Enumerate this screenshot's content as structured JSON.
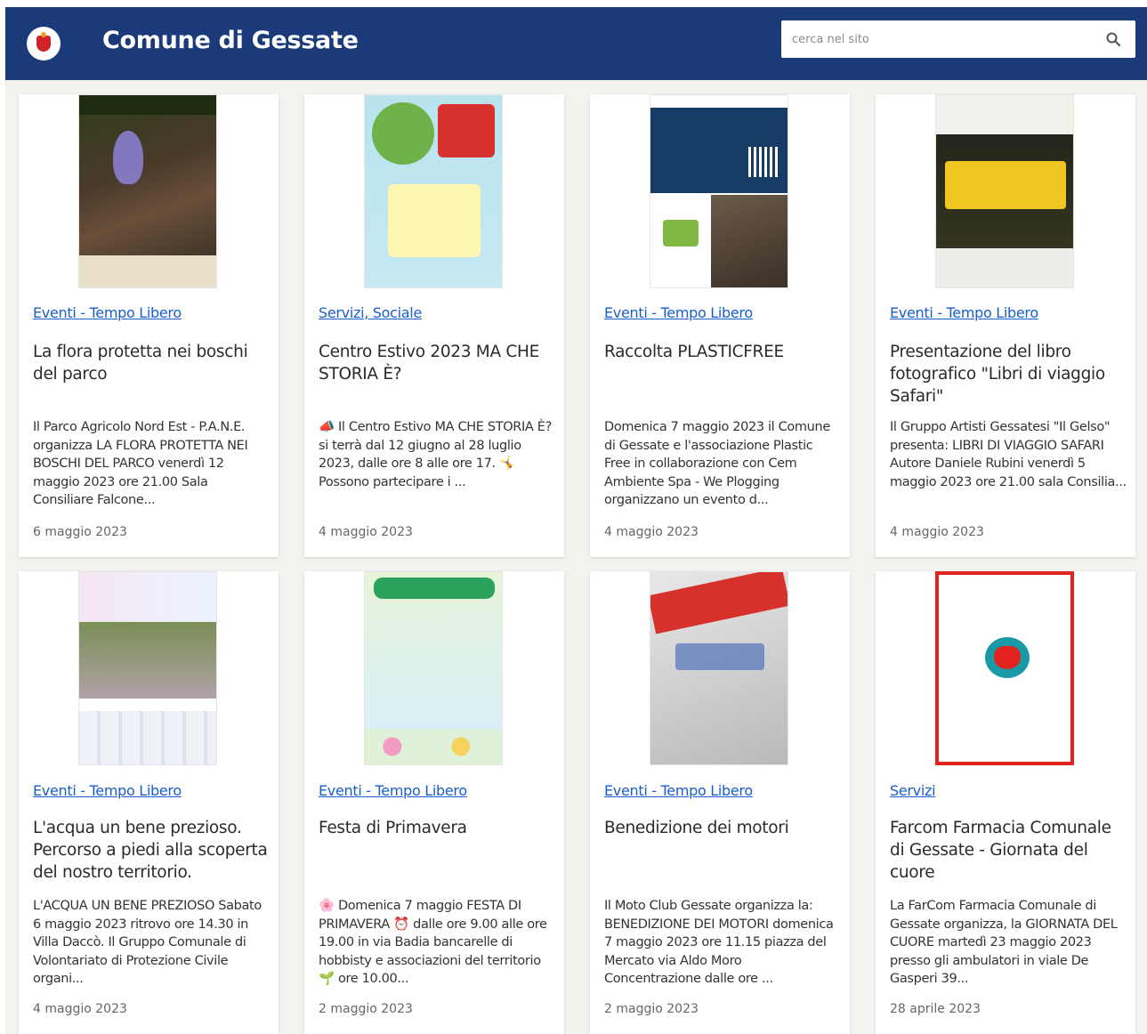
{
  "header": {
    "site_title": "Comune di Gessate",
    "search_placeholder": "cerca nel sito"
  },
  "colors": {
    "header_bg": "#1b3a7a",
    "link": "#1a5ec9",
    "page_bg": "#f2f2ef"
  },
  "cards": [
    {
      "category": "Eventi - Tempo Libero",
      "title": "La flora protetta nei boschi del parco",
      "excerpt": "Il Parco Agricolo Nord Est - P.A.N.E. organizza LA FLORA PROTETTA NEI BOSCHI DEL PARCO venerdì 12 maggio 2023 ore 21.00 Sala Consiliare Falcone...",
      "date": "6 maggio 2023"
    },
    {
      "category": "Servizi, Sociale",
      "title": "Centro Estivo 2023 MA CHE STORIA È?",
      "excerpt": "📣 Il Centro Estivo MA CHE STORIA È? si terrà dal 12 giugno al 28 luglio 2023, dalle ore 8 alle ore 17. 🤸 Possono partecipare i ...",
      "date": "4 maggio 2023"
    },
    {
      "category": "Eventi - Tempo Libero",
      "title": "Raccolta PLASTICFREE",
      "excerpt": "Domenica 7 maggio 2023 il Comune di Gessate e l'associazione Plastic Free in collaborazione con Cem Ambiente Spa - We Plogging organizzano un evento d...",
      "date": "4 maggio 2023"
    },
    {
      "category": "Eventi - Tempo Libero",
      "title": "Presentazione del libro fotografico \"Libri di viaggio Safari\"",
      "excerpt": "Il Gruppo Artisti Gessatesi \"Il Gelso\" presenta: LIBRI DI VIAGGIO SAFARI Autore Daniele Rubini venerdì 5 maggio 2023 ore 21.00 sala Consilia...",
      "date": "4 maggio 2023"
    },
    {
      "category": "Eventi - Tempo Libero",
      "title": "L'acqua un bene prezioso. Percorso a piedi alla scoperta del nostro territorio.",
      "excerpt": "L'ACQUA UN BENE PREZIOSO Sabato 6 maggio 2023 ritrovo ore 14.30 in Villa Daccò. Il Gruppo Comunale di Volontariato di Protezione Civile organi...",
      "date": "4 maggio 2023"
    },
    {
      "category": "Eventi - Tempo Libero",
      "title": "Festa di Primavera",
      "excerpt": "🌸 Domenica 7 maggio FESTA DI PRIMAVERA ⏰ dalle ore 9.00 alle ore 19.00 in via Badia bancarelle di hobbisty e associazioni del territorio 🌱 ore 10.00...",
      "date": "2 maggio 2023"
    },
    {
      "category": "Eventi - Tempo Libero",
      "title": "Benedizione dei motori",
      "excerpt": "Il Moto Club Gessate organizza la: BENEDIZIONE DEI MOTORI domenica 7 maggio 2023 ore 11.15 piazza del Mercato via Aldo Moro Concentrazione dalle ore ...",
      "date": "2 maggio 2023"
    },
    {
      "category": "Servizi",
      "title": "Farcom Farmacia Comunale di Gessate - Giornata del cuore",
      "excerpt": "La FarCom Farmacia Comunale di Gessate organizza, la GIORNATA DEL CUORE martedì 23 maggio 2023 presso gli ambulatori in viale De Gasperi 39...",
      "date": "28 aprile 2023"
    }
  ]
}
